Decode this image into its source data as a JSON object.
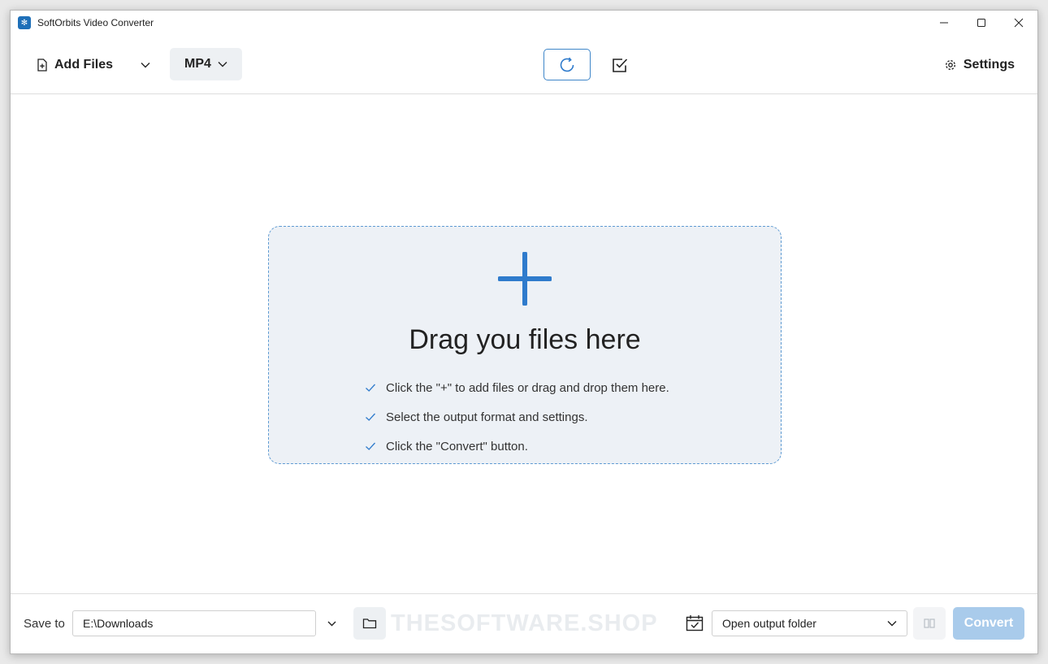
{
  "window": {
    "title": "SoftOrbits Video Converter"
  },
  "toolbar": {
    "add_files_label": "Add Files",
    "format_label": "MP4",
    "settings_label": "Settings"
  },
  "dropzone": {
    "title": "Drag you files here",
    "tips": [
      "Click the \"+\" to add files or drag and drop them here.",
      "Select the output format and settings.",
      "Click the \"Convert\" button."
    ]
  },
  "bottom": {
    "save_to_label": "Save to",
    "save_path": "E:\\Downloads",
    "watermark": "THESOFTWARE.SHOP",
    "after_action": "Open output folder",
    "convert_label": "Convert"
  },
  "colors": {
    "accent": "#3f86c9",
    "plus": "#2f7bcc",
    "convert_disabled": "#a9cbeb",
    "dropzone_bg": "#edf1f6"
  }
}
